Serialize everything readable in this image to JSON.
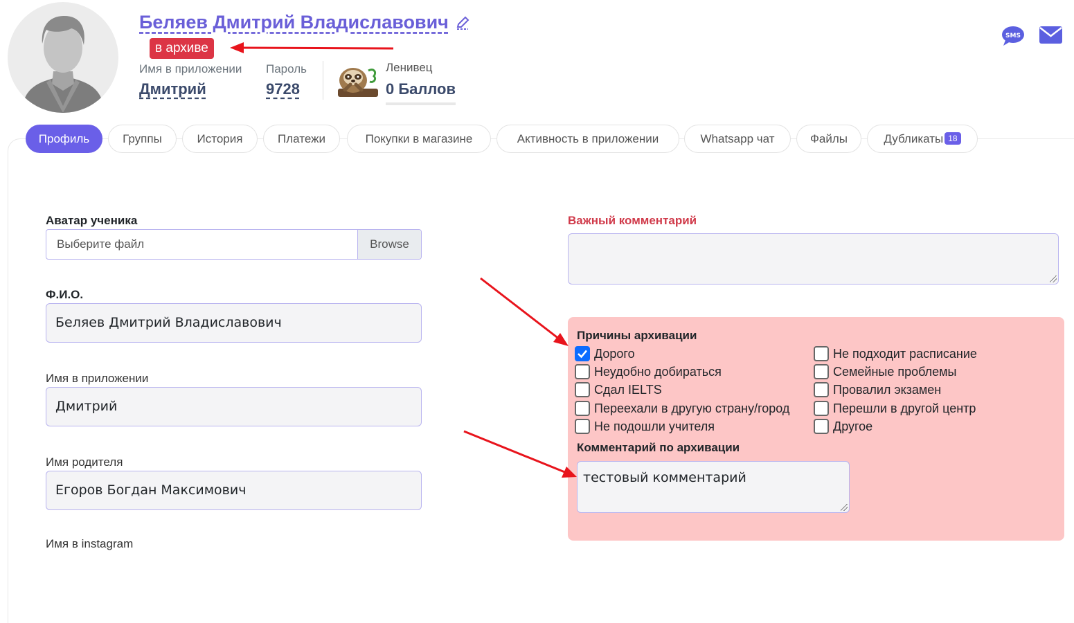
{
  "profile": {
    "full_name": "Беляев Дмитрий Владиславович",
    "status_badge": "в архиве",
    "app_name_label": "Имя в приложении",
    "app_name_value": "Дмитрий",
    "password_label": "Пароль",
    "password_value": "9728",
    "level_label": "Ленивец",
    "points_value": "0 Баллов"
  },
  "header_icons": {
    "sms": "sms-icon",
    "mail": "mail-icon",
    "edit": "pencil-icon"
  },
  "tabs": [
    {
      "label": "Профиль",
      "active": true
    },
    {
      "label": "Группы"
    },
    {
      "label": "История"
    },
    {
      "label": "Платежи"
    },
    {
      "label": "Покупки в магазине"
    },
    {
      "label": "Активность в приложении"
    },
    {
      "label": "Whatsapp чат"
    },
    {
      "label": "Файлы"
    },
    {
      "label": "Дубликаты",
      "badge": "18"
    }
  ],
  "form": {
    "avatar_label": "Аватар ученика",
    "file_placeholder": "Выберите файл",
    "browse_label": "Browse",
    "fio_label": "Ф.И.О.",
    "fio_value": "Беляев Дмитрий Владиславович",
    "app_name_label": "Имя в приложении",
    "app_name_value": "Дмитрий",
    "parent_label": "Имя родителя",
    "parent_value": "Егоров Богдан Максимович",
    "instagram_label": "Имя в instagram"
  },
  "important_comment": {
    "label": "Важный комментарий",
    "value": ""
  },
  "archive": {
    "title": "Причины архивации",
    "reasons_left": [
      {
        "label": "Дорого",
        "checked": true
      },
      {
        "label": "Неудобно добираться",
        "checked": false
      },
      {
        "label": "Сдал IELTS",
        "checked": false
      },
      {
        "label": "Переехали в другую страну/город",
        "checked": false
      },
      {
        "label": "Не подошли учителя",
        "checked": false
      }
    ],
    "reasons_right": [
      {
        "label": "Не подходит расписание",
        "checked": false
      },
      {
        "label": "Семейные проблемы",
        "checked": false
      },
      {
        "label": "Провалил экзамен",
        "checked": false
      },
      {
        "label": "Перешли в другой центр",
        "checked": false
      },
      {
        "label": "Другое",
        "checked": false
      }
    ],
    "comment_label": "Комментарий по архивации",
    "comment_value": "тестовый комментарий"
  },
  "colors": {
    "accent": "#6a5fe8",
    "danger": "#dc3545",
    "archive_panel": "#fdc6c6",
    "arrow": "#e8141c"
  }
}
